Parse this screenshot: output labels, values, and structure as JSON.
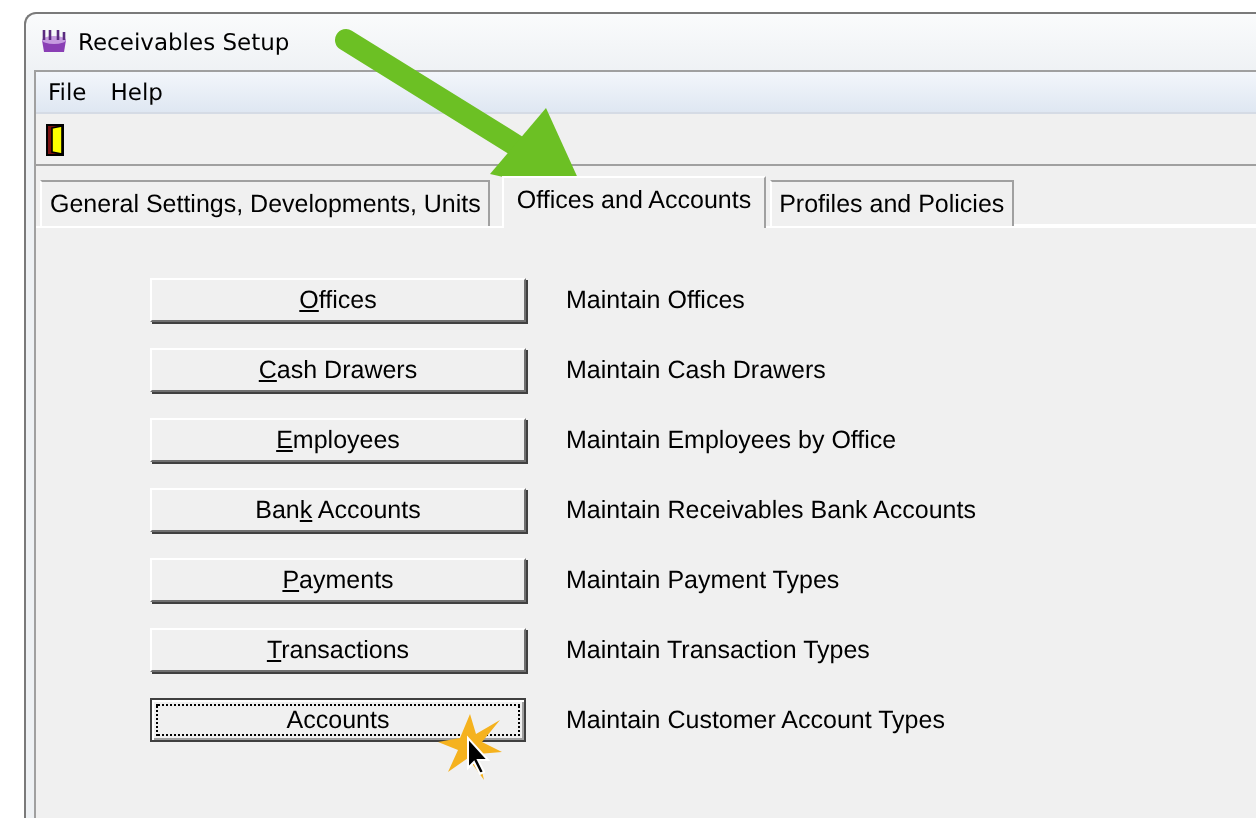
{
  "window": {
    "title": "Receivables Setup"
  },
  "menu": [
    "File",
    "Help"
  ],
  "tabs": [
    {
      "label": "General Settings, Developments, Units",
      "selected": false
    },
    {
      "label": "Offices and Accounts",
      "selected": true
    },
    {
      "label": "Profiles and Policies",
      "selected": false
    }
  ],
  "actions": [
    {
      "label_parts": [
        {
          "text": "O",
          "underlined": true
        },
        {
          "text": "ffices",
          "underlined": false
        }
      ],
      "description": "Maintain Offices",
      "focused": false
    },
    {
      "label_parts": [
        {
          "text": "C",
          "underlined": true
        },
        {
          "text": "ash Drawers",
          "underlined": false
        }
      ],
      "description": "Maintain Cash Drawers",
      "focused": false
    },
    {
      "label_parts": [
        {
          "text": "E",
          "underlined": true
        },
        {
          "text": "mployees",
          "underlined": false
        }
      ],
      "description": "Maintain Employees by Office",
      "focused": false
    },
    {
      "label_parts": [
        {
          "text": "Ban",
          "underlined": false
        },
        {
          "text": "k",
          "underlined": true
        },
        {
          "text": " Accounts",
          "underlined": false
        }
      ],
      "description": "Maintain Receivables Bank Accounts",
      "focused": false
    },
    {
      "label_parts": [
        {
          "text": "P",
          "underlined": true
        },
        {
          "text": "ayments",
          "underlined": false
        }
      ],
      "description": "Maintain Payment Types",
      "focused": false
    },
    {
      "label_parts": [
        {
          "text": "T",
          "underlined": true
        },
        {
          "text": "ransactions",
          "underlined": false
        }
      ],
      "description": "Maintain Transaction Types",
      "focused": false
    },
    {
      "label_parts": [
        {
          "text": "Accounts",
          "underlined": false
        }
      ],
      "description": "Maintain Customer Account Types",
      "focused": true
    }
  ]
}
